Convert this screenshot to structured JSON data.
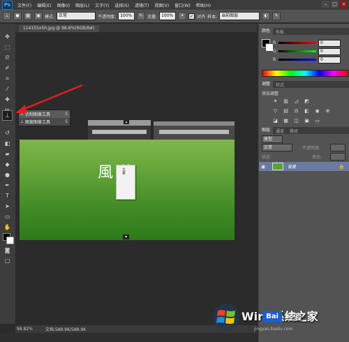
{
  "menubar": {
    "logo": "Ps",
    "items": [
      "文件(F)",
      "编辑(E)",
      "图像(I)",
      "图层(L)",
      "文字(Y)",
      "选择(S)",
      "滤镜(T)",
      "视图(V)",
      "窗口(W)",
      "帮助(H)"
    ],
    "window_controls": [
      "–",
      "□",
      "×"
    ]
  },
  "options_bar": {
    "mode_label": "模式:",
    "mode_value": "正常",
    "opacity_label": "不透明度:",
    "opacity_value": "100%",
    "flow_label": "流量:",
    "flow_value": "100%",
    "aligned_label": "对齐",
    "sample_label": "样本:",
    "sample_value": "当前图层"
  },
  "document": {
    "tab_label": "114155x5h.jpg @ 98.8%(RGB/8#)",
    "calligraphy": "風 薫",
    "card_text": "立夏"
  },
  "flyout": {
    "items": [
      {
        "label": "仿制图章工具",
        "shortcut": "S"
      },
      {
        "label": "图案图章工具",
        "shortcut": "S"
      }
    ]
  },
  "status": {
    "zoom": "98.82%",
    "doc_size": "文档:588.9K/588.9K"
  },
  "panels": {
    "color_tabs": [
      "颜色",
      "色板"
    ],
    "rgb": [
      {
        "channel": "R",
        "value": "0"
      },
      {
        "channel": "G",
        "value": "0"
      },
      {
        "channel": "B",
        "value": "0"
      }
    ],
    "adjust_tabs": [
      "调整",
      "样式"
    ],
    "adjust_title": "添加调整",
    "layer_tabs": [
      "图层",
      "通道",
      "路径"
    ],
    "layer_kind": "类型",
    "blend_mode": "正常",
    "opacity_label": "不透明度:",
    "lock_label": "锁定:",
    "fill_label": "填充:",
    "layer_name": "背景"
  },
  "watermark": {
    "brand": "Win7系统之家",
    "baidu": "Bai",
    "jingyan": "经验",
    "site": "jingyan.baidu.com"
  },
  "colors": {
    "menubar": "#3c3c3c",
    "panel": "#535353",
    "accent_arrow": "#e02020",
    "layer_selected": "#6a7aa0"
  }
}
